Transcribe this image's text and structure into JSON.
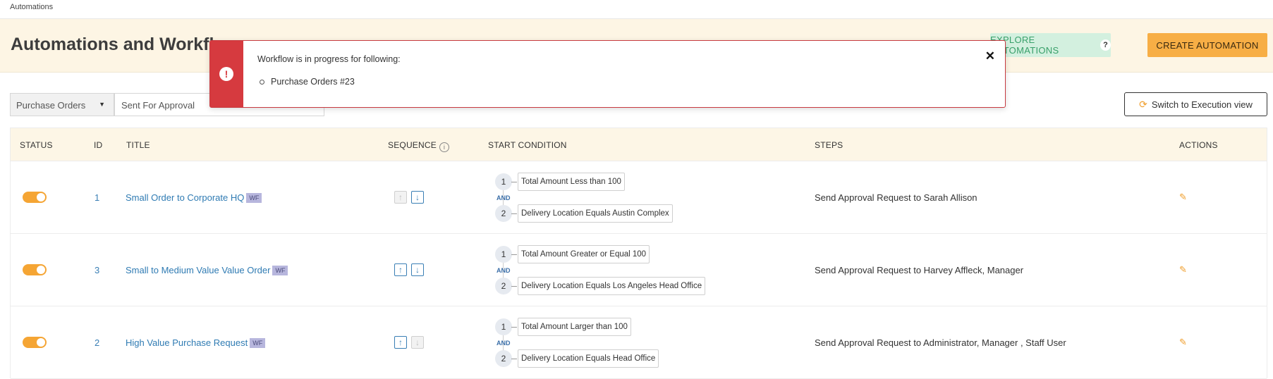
{
  "breadcrumb": "Automations",
  "header": {
    "title": "Automations and Workflows",
    "explore_label": "EXPLORE AUTOMATIONS",
    "explore_help": "?",
    "create_label": "CREATE AUTOMATION"
  },
  "filters": {
    "module": "Purchase Orders",
    "event": "Sent For Approval"
  },
  "switch_label": "Switch to Execution view",
  "table": {
    "headers": [
      "STATUS",
      "ID",
      "TITLE",
      "SEQUENCE",
      "START CONDITION",
      "STEPS",
      "ACTIONS"
    ],
    "rows": [
      {
        "status_on": true,
        "id": "1",
        "title": "Small Order to Corporate HQ",
        "badge": "WF",
        "seq_up_enabled": false,
        "seq_down_enabled": true,
        "conditions": [
          {
            "num": "1",
            "text": "Total Amount Less than 100"
          },
          {
            "num": "2",
            "text": "Delivery Location Equals Austin Complex"
          }
        ],
        "joiner": "AND",
        "steps": "Send Approval Request to Sarah Allison"
      },
      {
        "status_on": true,
        "id": "3",
        "title": "Small to Medium Value Value Order",
        "badge": "WF",
        "seq_up_enabled": true,
        "seq_down_enabled": true,
        "conditions": [
          {
            "num": "1",
            "text": "Total Amount Greater or Equal 100"
          },
          {
            "num": "2",
            "text": "Delivery Location Equals Los Angeles Head Office"
          }
        ],
        "joiner": "AND",
        "steps": "Send Approval Request to Harvey Affleck, Manager"
      },
      {
        "status_on": true,
        "id": "2",
        "title": "High Value Purchase Request",
        "badge": "WF",
        "seq_up_enabled": true,
        "seq_down_enabled": false,
        "conditions": [
          {
            "num": "1",
            "text": "Total Amount Larger than 100"
          },
          {
            "num": "2",
            "text": "Delivery Location Equals Head Office"
          }
        ],
        "joiner": "AND",
        "steps": "Send Approval Request to Administrator, Manager , Staff User"
      }
    ]
  },
  "alert": {
    "message": "Workflow is in progress for following:",
    "items": [
      "Purchase Orders #23"
    ],
    "close_glyph": "✕",
    "icon_glyph": "!"
  },
  "colors": {
    "accent": "#f5a534",
    "link": "#2f7bb3",
    "alert": "#d63a3f",
    "explore_bg": "#d3f0df"
  }
}
